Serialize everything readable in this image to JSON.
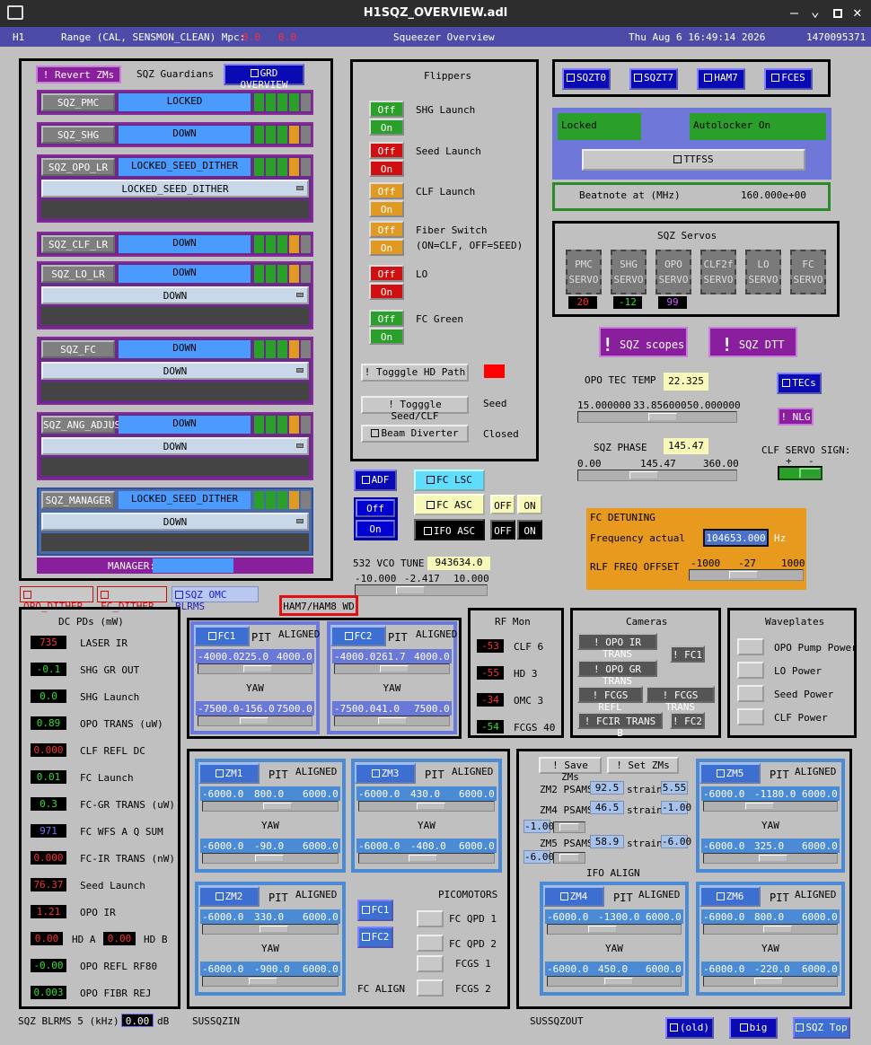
{
  "window": {
    "title": "H1SQZ_OVERVIEW.adl"
  },
  "menubar": {
    "site": "H1",
    "range_label": "Range (CAL, SENSMON_CLEAN) Mpc:",
    "range1": "0.0",
    "range2": "0.0",
    "title": "Squeezer Overview",
    "date": "Thu Aug  6 16:49:14 2026",
    "gps": "1470095371"
  },
  "guardians": {
    "revert": "! Revert ZMs",
    "title": "SQZ Guardians",
    "overview": "GRD OVERVIEW",
    "pmc": {
      "name": "SQZ_PMC",
      "state": "LOCKED"
    },
    "shg": {
      "name": "SQZ_SHG",
      "state": "DOWN"
    },
    "opo": {
      "name": "SQZ_OPO_LR",
      "state": "LOCKED_SEED_DITHER",
      "req": "LOCKED_SEED_DITHER"
    },
    "clf": {
      "name": "SQZ_CLF_LR",
      "state": "DOWN"
    },
    "lo": {
      "name": "SQZ_LO_LR",
      "state": "DOWN",
      "req": "DOWN"
    },
    "fc": {
      "name": "SQZ_FC",
      "state": "DOWN",
      "req": "DOWN"
    },
    "ang": {
      "name": "SQZ_ANG_ADJUST",
      "state": "DOWN",
      "req": "DOWN"
    },
    "mgr": {
      "name": "SQZ_MANAGER",
      "state": "LOCKED_SEED_DITHER",
      "req": "DOWN"
    },
    "manager_label": "MANAGER:"
  },
  "flippers": {
    "title": "Flippers",
    "off": "Off",
    "on": "On",
    "shg": "SHG Launch",
    "seed": "Seed Launch",
    "clf": "CLF Launch",
    "fiber": "Fiber Switch",
    "fiber2": "(ON=CLF, OFF=SEED)",
    "lo": "LO",
    "fcg": "FC Green",
    "hd": "! Togggle HD Path",
    "seedclf": "! Togggle Seed/CLF",
    "seed_state": "Seed",
    "diverter": "Beam Diverter",
    "diverter_state": "Closed"
  },
  "topright": {
    "b1": "SQZT0",
    "b2": "SQZT7",
    "b3": "HAM7",
    "b4": "FCES",
    "locked": "Locked",
    "autolocker": "Autolocker On",
    "ttfss": "TTFSS",
    "beatnote_label": "Beatnote at (MHz)",
    "beatnote": "160.000e+00"
  },
  "servos": {
    "title": "SQZ Servos",
    "items": [
      {
        "l1": "PMC",
        "l2": "SERVO",
        "v": "20",
        "c": "#ff3030"
      },
      {
        "l1": "SHG",
        "l2": "SERVO",
        "v": "-12",
        "c": "#30e030"
      },
      {
        "l1": "OPO",
        "l2": "SERVO",
        "v": "99",
        "c": "#d060ff"
      },
      {
        "l1": "CLF2f",
        "l2": "SERVO",
        "v": ""
      },
      {
        "l1": "LO",
        "l2": "SERVO",
        "v": ""
      },
      {
        "l1": "FC",
        "l2": "SERVO",
        "v": ""
      }
    ],
    "scopes": "SQZ scopes",
    "dtt": "SQZ DTT"
  },
  "opo_tec": {
    "label": "OPO TEC TEMP",
    "value": "22.325",
    "min": "15.000000",
    "mid": "33.856000",
    "max": "50.000000",
    "tecs": "TECs",
    "nlg": "! NLG",
    "level": 0.55
  },
  "sqz_phase": {
    "label": "SQZ PHASE",
    "value": "145.47",
    "min": "0.00",
    "mid": "145.47",
    "max": "360.00",
    "clf_sign": "CLF SERVO SIGN:",
    "plus": "+",
    "minus": "-",
    "level": 0.4
  },
  "mid": {
    "adf": "ADF",
    "off": "Off",
    "on": "On",
    "fclsc": "FC LSC",
    "fcasc": "FC ASC",
    "ifoasc": "IFO ASC",
    "off2": "OFF",
    "on2": "ON",
    "vco_label": "532 VCO TUNE",
    "vco": "943634.0",
    "vmin": "-10.000",
    "vmid": "-2.417",
    "vmax": "10.000",
    "level": 0.4
  },
  "fcdet": {
    "title": "FC DETUNING",
    "freq_label": "Frequency actual",
    "freq": "104653.000",
    "unit": "Hz",
    "rlf_label": "RLF FREQ OFFSET",
    "rmin": "-1000",
    "rmid": "-27",
    "rmax": "1000",
    "level": 0.48
  },
  "links": {
    "opo": "OPO_DITHER",
    "fc": "FC_DITHER",
    "omc": "SQZ OMC BLRMS",
    "wd": "HAM7/HAM8 WD"
  },
  "dcpd": {
    "title": "DC PDs (mW)",
    "rows": [
      {
        "v": "735",
        "c": "#ff3030",
        "l": "LASER IR"
      },
      {
        "v": "-0.1",
        "c": "#30e030",
        "l": "SHG GR OUT"
      },
      {
        "v": "0.0",
        "c": "#30e030",
        "l": "SHG Launch"
      },
      {
        "v": "0.89",
        "c": "#30e030",
        "l": "OPO TRANS (uW)"
      },
      {
        "v": "0.000",
        "c": "#ff3030",
        "l": "CLF REFL DC"
      },
      {
        "v": "0.01",
        "c": "#30e030",
        "l": "FC Launch"
      },
      {
        "v": "0.3",
        "c": "#30e030",
        "l": "FC-GR TRANS (uW)"
      },
      {
        "v": "971",
        "c": "#7070ff",
        "l": "FC WFS A Q SUM"
      },
      {
        "v": "0.000",
        "c": "#ff3030",
        "l": "FC-IR TRANS (nW)"
      },
      {
        "v": "76.37",
        "c": "#ff3030",
        "l": "Seed Launch"
      },
      {
        "v": "1.21",
        "c": "#ff3030",
        "l": "OPO IR"
      }
    ],
    "hda": "0.00",
    "hdb": "0.00",
    "hda_l": "HD A",
    "hdb_l": "HD B",
    "rf80": "-0.00",
    "rf80_l": "OPO REFL RF80",
    "fibr": "0.003",
    "fibr_l": "OPO FIBR REJ"
  },
  "blrms": {
    "label": "SQZ BLRMS 5 (kHz):",
    "value": "0.00",
    "unit": "dB"
  },
  "fc1": {
    "name": "FC1",
    "pit": "PIT",
    "aligned": "ALIGNED",
    "pmin": "-4000.0",
    "pval": "225.0",
    "pmax": "4000.0",
    "yaw": "YAW",
    "ymin": "-7500.0",
    "yval": "-156.0",
    "ymax": "7500.0",
    "pl": 0.53,
    "yl": 0.49
  },
  "fc2": {
    "name": "FC2",
    "pit": "PIT",
    "aligned": "ALIGNED",
    "pmin": "-4000.0",
    "pval": "261.7",
    "pmax": "4000.0",
    "yaw": "YAW",
    "ymin": "-7500.0",
    "yval": "41.0",
    "ymax": "7500.0",
    "pl": 0.53,
    "yl": 0.5
  },
  "rfmon": {
    "title": "RF Mon",
    "rows": [
      {
        "v": "-53",
        "c": "#ff3030",
        "l": "CLF 6"
      },
      {
        "v": "-55",
        "c": "#ff3030",
        "l": "HD 3"
      },
      {
        "v": "-34",
        "c": "#ff3030",
        "l": "OMC 3"
      },
      {
        "v": "-54",
        "c": "#30e030",
        "l": "FCGS 40"
      }
    ]
  },
  "cameras": {
    "title": "Cameras",
    "c1": "! OPO IR TRANS",
    "c2": "! FC1",
    "c3": "! OPO GR TRANS",
    "c4": "! FCGS REFL",
    "c5": "! FCGS TRANS",
    "c6": "! FCIR TRANS B",
    "c7": "! FC2"
  },
  "waveplates": {
    "title": "Waveplates",
    "w1": "OPO Pump Power",
    "w2": "LO Power",
    "w3": "Seed Power",
    "w4": "CLF Power"
  },
  "zm1": {
    "name": "ZM1",
    "pit": "PIT",
    "aligned": "ALIGNED",
    "pmin": "-6000.0",
    "pval": "800.0",
    "pmax": "6000.0",
    "yaw": "YAW",
    "ymin": "-6000.0",
    "yval": "-90.0",
    "ymax": "6000.0",
    "pl": 0.57,
    "yl": 0.49
  },
  "zm3": {
    "name": "ZM3",
    "pit": "PIT",
    "aligned": "ALIGNED",
    "pmin": "-6000.0",
    "pval": "430.0",
    "pmax": "6000.0",
    "yaw": "YAW",
    "ymin": "-6000.0",
    "yval": "-400.0",
    "ymax": "6000.0",
    "pl": 0.54,
    "yl": 0.47
  },
  "zm2": {
    "name": "ZM2",
    "pit": "PIT",
    "aligned": "ALIGNED",
    "pmin": "-6000.0",
    "pval": "330.0",
    "pmax": "6000.0",
    "yaw": "YAW",
    "ymin": "-6000.0",
    "yval": "-900.0",
    "ymax": "6000.0",
    "pl": 0.53,
    "yl": 0.43
  },
  "zm5": {
    "name": "ZM5",
    "pit": "PIT",
    "aligned": "ALIGNED",
    "pmin": "-6000.0",
    "pval": "-1180.0",
    "pmax": "6000.0",
    "yaw": "YAW",
    "ymin": "-6000.0",
    "yval": "325.0",
    "ymax": "6000.0",
    "pl": 0.4,
    "yl": 0.53
  },
  "zm4": {
    "name": "ZM4",
    "pit": "PIT",
    "aligned": "ALIGNED",
    "pmin": "-6000.0",
    "pval": "-1300.0",
    "pmax": "6000.0",
    "yaw": "YAW",
    "ymin": "-6000.0",
    "yval": "450.0",
    "ymax": "6000.0",
    "pl": 0.39,
    "yl": 0.54
  },
  "zm6": {
    "name": "ZM6",
    "pit": "PIT",
    "aligned": "ALIGNED",
    "pmin": "-6000.0",
    "pval": "800.0",
    "pmax": "6000.0",
    "yaw": "YAW",
    "ymin": "-6000.0",
    "yval": "-220.0",
    "ymax": "6000.0",
    "pl": 0.57,
    "yl": 0.48
  },
  "fcalign": {
    "fc1": "FC1",
    "fc2": "FC2",
    "picomotors": "PICOMOTORS",
    "q1": "FC QPD 1",
    "q2": "FC QPD 2",
    "g1": "FCGS 1",
    "g2": "FCGS 2",
    "label": "FC ALIGN"
  },
  "psams": {
    "save": "! Save ZMs",
    "set": "! Set ZMs",
    "zm2": "ZM2 PSAMS",
    "zm2v": "92.5",
    "zm2s": "5.55",
    "zm4": "ZM4 PSAMS",
    "zm4v": "46.5",
    "zm4s": "-1.00",
    "zm4b": "-1.00",
    "zm5": "ZM5 PSAMS",
    "zm5v": "58.9",
    "zm5s": "-6.00",
    "zm5b": "-6.00",
    "strain": "strain",
    "ifo": "IFO ALIGN"
  },
  "footer": {
    "in": "SUSSQZIN",
    "out": "SUSSQZOUT",
    "old": "(old)",
    "big": "big",
    "top": "SQZ Top"
  }
}
